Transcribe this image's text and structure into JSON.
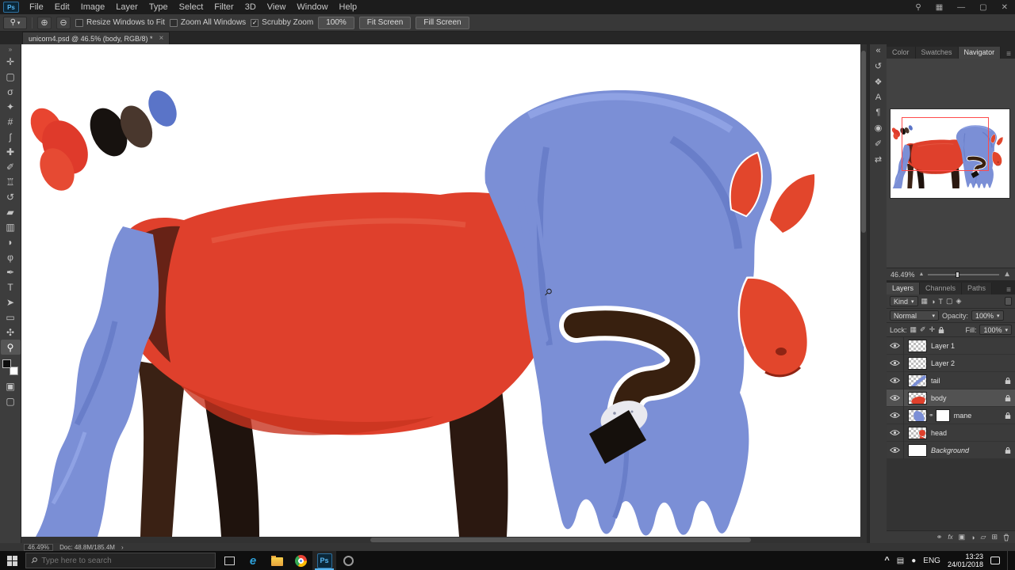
{
  "menu": [
    "File",
    "Edit",
    "Image",
    "Layer",
    "Type",
    "Select",
    "Filter",
    "3D",
    "View",
    "Window",
    "Help"
  ],
  "options": {
    "resize_label": "Resize Windows to Fit",
    "zoom_all_label": "Zoom All Windows",
    "scrubby_label": "Scrubby Zoom",
    "btn_100": "100%",
    "btn_fit": "Fit Screen",
    "btn_fill": "Fill Screen"
  },
  "doc_tab": {
    "title": "unicorn4.psd @ 46.5% (body, RGB/8) *",
    "close": "×"
  },
  "tools": [
    {
      "name": "move-tool",
      "glyph": "✛"
    },
    {
      "name": "marquee-tool",
      "glyph": "▢"
    },
    {
      "name": "lasso-tool",
      "glyph": "σ"
    },
    {
      "name": "quick-selection-tool",
      "glyph": "✦"
    },
    {
      "name": "crop-tool",
      "glyph": "#"
    },
    {
      "name": "eyedropper-tool",
      "glyph": "ʃ"
    },
    {
      "name": "healing-brush-tool",
      "glyph": "✚"
    },
    {
      "name": "brush-tool",
      "glyph": "✐"
    },
    {
      "name": "clone-stamp-tool",
      "glyph": "♖"
    },
    {
      "name": "history-brush-tool",
      "glyph": "↺"
    },
    {
      "name": "eraser-tool",
      "glyph": "▰"
    },
    {
      "name": "gradient-tool",
      "glyph": "▥"
    },
    {
      "name": "blur-tool",
      "glyph": "◗"
    },
    {
      "name": "dodge-tool",
      "glyph": "φ"
    },
    {
      "name": "pen-tool",
      "glyph": "✒"
    },
    {
      "name": "type-tool",
      "glyph": "T"
    },
    {
      "name": "path-selection-tool",
      "glyph": "➤"
    },
    {
      "name": "shape-tool",
      "glyph": "▭"
    },
    {
      "name": "hand-tool",
      "glyph": "✣"
    },
    {
      "name": "zoom-tool",
      "glyph": "⚲"
    }
  ],
  "toolbar_extra": {
    "quick_mask": "▣",
    "screen_mode": "▢",
    "collapse": "»"
  },
  "strip_icons": [
    {
      "name": "collapse-panels",
      "glyph": "«"
    },
    {
      "name": "history-panel",
      "glyph": "↺"
    },
    {
      "name": "styles-panel",
      "glyph": "❖"
    },
    {
      "name": "character-panel",
      "glyph": "A"
    },
    {
      "name": "paragraph-panel",
      "glyph": "¶"
    },
    {
      "name": "clone-source-panel",
      "glyph": "◉"
    },
    {
      "name": "brush-settings-panel",
      "glyph": "✐"
    },
    {
      "name": "tool-presets-panel",
      "glyph": "⇄"
    }
  ],
  "navigator": {
    "tabs": [
      "Color",
      "Swatches",
      "Navigator"
    ],
    "zoom": "46.49%"
  },
  "layers_panel": {
    "tabs": [
      "Layers",
      "Channels",
      "Paths"
    ],
    "kind": "Kind",
    "blend_mode": "Normal",
    "opacity_label": "Opacity:",
    "opacity": "100%",
    "lock_label": "Lock:",
    "fill_label": "Fill:",
    "fill": "100%",
    "items": [
      {
        "name": "Layer 1"
      },
      {
        "name": "Layer 2"
      },
      {
        "name": "tail"
      },
      {
        "name": "body"
      },
      {
        "name": "mane"
      },
      {
        "name": "head"
      },
      {
        "name": "Background"
      }
    ]
  },
  "status": {
    "zoom": "46.49%",
    "doc": "Doc: 48.8M/185.4M",
    "arrow": "›"
  },
  "taskbar": {
    "search_placeholder": "Type here to search",
    "lang": "ENG",
    "time": "13:23",
    "date": "24/01/2018"
  },
  "icons": {
    "ps_logo": "Ps",
    "search": "⚲",
    "workspace": "▦",
    "minimize": "—",
    "maximize": "▢",
    "close": "✕",
    "zoom_tool": "⚲",
    "dropdown": "▾",
    "zoom_in": "⊕",
    "zoom_out": "⊖",
    "check": "✓",
    "panel_menu": "≡",
    "mountain": "▲",
    "filter_pixel": "▦",
    "filter_adjust": "◑",
    "filter_type": "T",
    "filter_shape": "▢",
    "filter_smart": "◈",
    "lock_transparent": "▦",
    "lock_paint": "✐",
    "lock_position": "✛",
    "link": "⚭",
    "fx": "fx",
    "mask": "▣",
    "adjust": "◑",
    "group": "▱",
    "new_layer": "⊞",
    "tray_generic": "▤",
    "tray_dot": "●",
    "chevron_up": "^",
    "edge": "e"
  },
  "artwork_colors": {
    "body_red": "#df402c",
    "shade_red": "#c8331f",
    "dark_maroon": "#5c2015",
    "mane_blue": "#7b8fd6",
    "mane_shade": "#697ec9",
    "mane_light": "#8fa2e4",
    "leg_dark": "#2b1810",
    "hoof_black": "#15100c",
    "hoof_white": "#e9e9ef"
  }
}
